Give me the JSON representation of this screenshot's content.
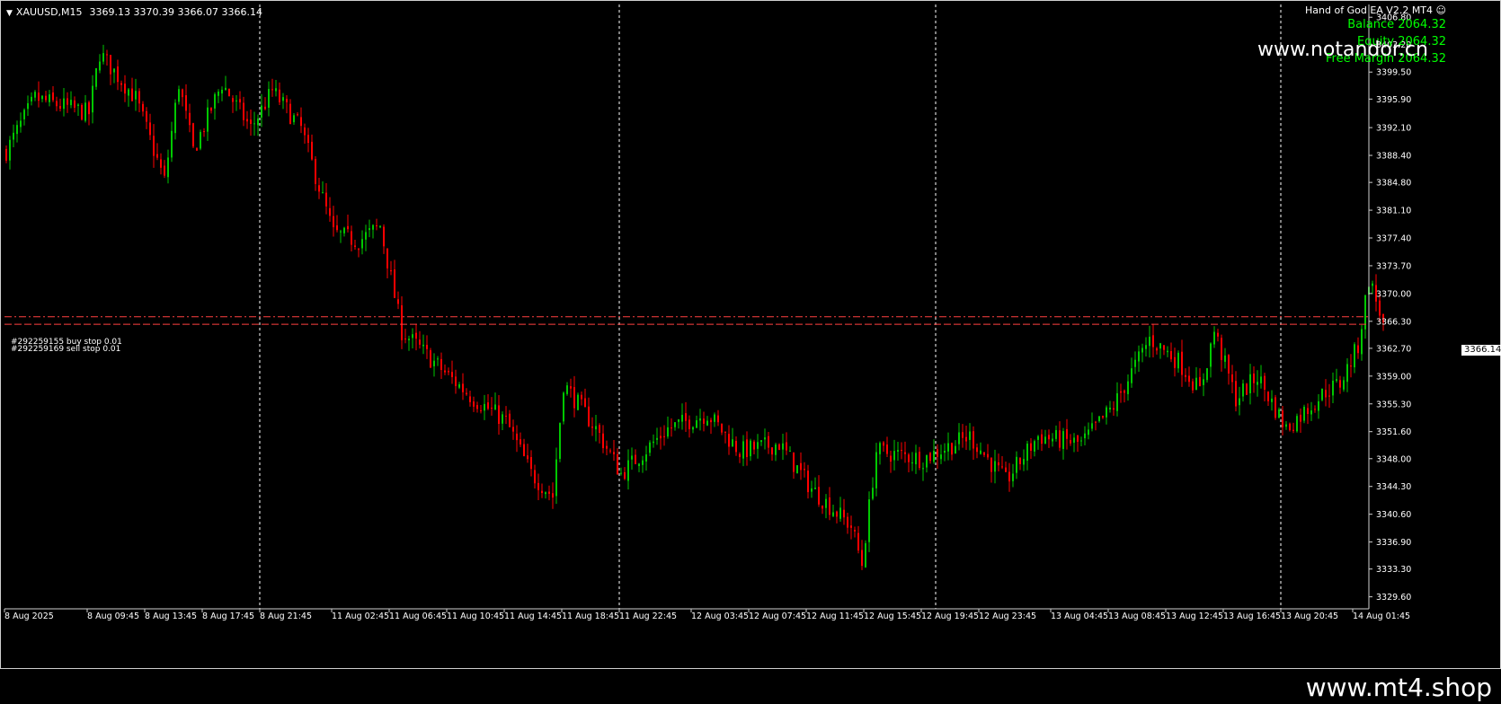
{
  "symbol": {
    "name": "XAUUSD,M15",
    "open": "3369.13",
    "high": "3370.39",
    "low": "3366.07",
    "close": "3366.14"
  },
  "ea_panel": {
    "title": "Hand of God EA  V2.2 MT4",
    "balance": "Balance 2064.32",
    "equity": "Equity 2064.32",
    "free_margin": "Free Margin 2064.32"
  },
  "watermarks": {
    "top": "www.notandor.cn",
    "bottom": "www.mt4.shop"
  },
  "orders": [
    {
      "label": "#292259155 buy stop 0.01",
      "price": 3366.9
    },
    {
      "label": "#292259169 sell stop 0.01",
      "price": 3365.9
    }
  ],
  "current_price_label": "3366.14",
  "colors": {
    "background": "#000000",
    "bull": "#00c800",
    "bear": "#ff0000",
    "grid": "#ffffff",
    "order_line": "#ff4040",
    "text": "#ffffff",
    "ea_text": "#00ff00"
  },
  "chart_data": {
    "type": "candlestick",
    "ylim": [
      3328.0,
      3408.5
    ],
    "y_ticks": [
      "3406.80",
      "3403.20",
      "3399.50",
      "3395.90",
      "3392.10",
      "3388.40",
      "3384.80",
      "3381.10",
      "3377.40",
      "3373.70",
      "3370.00",
      "3366.30",
      "3362.70",
      "3359.00",
      "3355.30",
      "3351.60",
      "3348.00",
      "3344.30",
      "3340.60",
      "3336.90",
      "3333.30",
      "3329.60"
    ],
    "x_ticks": [
      "8 Aug 2025",
      "8 Aug 09:45",
      "8 Aug 13:45",
      "8 Aug 17:45",
      "8 Aug 21:45",
      "11 Aug 02:45",
      "11 Aug 06:45",
      "11 Aug 10:45",
      "11 Aug 14:45",
      "11 Aug 18:45",
      "11 Aug 22:45",
      "12 Aug 03:45",
      "12 Aug 07:45",
      "12 Aug 11:45",
      "12 Aug 15:45",
      "12 Aug 19:45",
      "12 Aug 23:45",
      "13 Aug 04:45",
      "13 Aug 08:45",
      "13 Aug 12:45",
      "13 Aug 16:45",
      "13 Aug 20:45",
      "14 Aug 01:45"
    ],
    "day_separators": [
      "8 Aug 21:45",
      "11 Aug 22:45",
      "12 Aug 20:45",
      "13 Aug 20:45"
    ],
    "close_path": [
      [
        "8 Aug 2025",
        3389
      ],
      [
        "8 Aug 06:00",
        3396
      ],
      [
        "8 Aug 09:45",
        3394
      ],
      [
        "8 Aug 10:30",
        3402
      ],
      [
        "8 Aug 13:00",
        3396
      ],
      [
        "8 Aug 15:00",
        3385
      ],
      [
        "8 Aug 16:00",
        3398
      ],
      [
        "8 Aug 17:00",
        3389
      ],
      [
        "8 Aug 19:00",
        3398
      ],
      [
        "8 Aug 21:00",
        3392
      ],
      [
        "8 Aug 22:30",
        3397
      ],
      [
        "11 Aug 00:30",
        3392
      ],
      [
        "11 Aug 02:45",
        3378
      ],
      [
        "11 Aug 04:30",
        3377
      ],
      [
        "11 Aug 06:00",
        3379
      ],
      [
        "11 Aug 07:30",
        3365
      ],
      [
        "11 Aug 10:45",
        3359
      ],
      [
        "11 Aug 12:30",
        3356
      ],
      [
        "11 Aug 14:45",
        3353
      ],
      [
        "11 Aug 16:30",
        3346
      ],
      [
        "11 Aug 18:00",
        3343
      ],
      [
        "11 Aug 18:45",
        3358
      ],
      [
        "11 Aug 21:00",
        3352
      ],
      [
        "11 Aug 22:45",
        3346
      ],
      [
        "12 Aug 02:00",
        3352
      ],
      [
        "12 Aug 04:45",
        3354
      ],
      [
        "12 Aug 07:00",
        3349
      ],
      [
        "12 Aug 09:45",
        3350
      ],
      [
        "12 Aug 12:00",
        3344
      ],
      [
        "12 Aug 14:45",
        3339
      ],
      [
        "12 Aug 15:30",
        3334
      ],
      [
        "12 Aug 16:30",
        3349
      ],
      [
        "12 Aug 19:45",
        3348
      ],
      [
        "12 Aug 23:00",
        3351
      ],
      [
        "13 Aug 01:30",
        3345
      ],
      [
        "13 Aug 03:45",
        3351
      ],
      [
        "13 Aug 06:45",
        3350
      ],
      [
        "13 Aug 09:00",
        3355
      ],
      [
        "13 Aug 11:30",
        3364
      ],
      [
        "13 Aug 13:30",
        3361
      ],
      [
        "13 Aug 15:00",
        3357
      ],
      [
        "13 Aug 16:00",
        3365
      ],
      [
        "13 Aug 17:30",
        3356
      ],
      [
        "13 Aug 19:00",
        3359
      ],
      [
        "13 Aug 21:00",
        3352
      ],
      [
        "13 Aug 23:45",
        3357
      ],
      [
        "14 Aug 00:45",
        3358
      ],
      [
        "14 Aug 02:00",
        3363
      ],
      [
        "14 Aug 02:45",
        3372
      ],
      [
        "14 Aug 03:45",
        3366.14
      ]
    ]
  }
}
